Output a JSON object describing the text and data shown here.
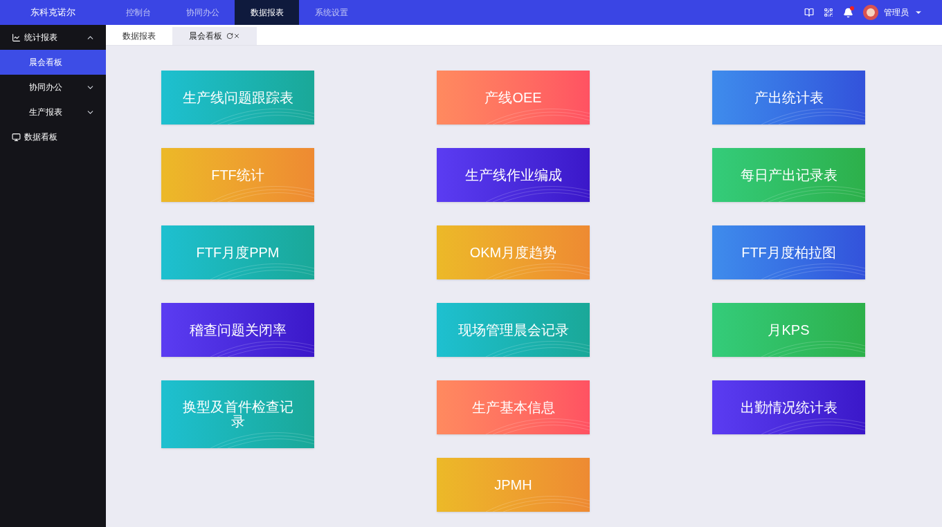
{
  "app_title": "东科克诺尔",
  "nav": [
    {
      "label": "控制台",
      "selected": false
    },
    {
      "label": "协同办公",
      "selected": false
    },
    {
      "label": "数据报表",
      "selected": true
    },
    {
      "label": "系统设置",
      "selected": false
    }
  ],
  "user": {
    "name": "管理员",
    "has_notification": true
  },
  "sidebar": {
    "items": [
      {
        "label": "统计报表",
        "kind": "chart",
        "expanded": true,
        "selected": false,
        "children": [
          {
            "label": "晨会看板",
            "selected": true
          },
          {
            "label": "协同办公",
            "selected": false,
            "expanded": false
          },
          {
            "label": "生产报表",
            "selected": false,
            "expanded": false
          }
        ]
      },
      {
        "label": "数据看板",
        "kind": "monitor",
        "selected": false
      }
    ]
  },
  "tabs": [
    {
      "label": "数据报表",
      "selected": false,
      "closable": false
    },
    {
      "label": "晨会看板",
      "selected": true,
      "closable": true
    }
  ],
  "cards": [
    {
      "label": "生产线问题跟踪表",
      "kind": "teal"
    },
    {
      "label": "产线OEE",
      "kind": "coral"
    },
    {
      "label": "产出统计表",
      "kind": "blue"
    },
    {
      "label": "FTF统计",
      "kind": "orange"
    },
    {
      "label": "生产线作业编成",
      "kind": "purple"
    },
    {
      "label": "每日产出记录表",
      "kind": "green"
    },
    {
      "label": "FTF月度PPM",
      "kind": "teal"
    },
    {
      "label": "OKM月度趋势",
      "kind": "orange"
    },
    {
      "label": "FTF月度柏拉图",
      "kind": "blue"
    },
    {
      "label": "稽查问题关闭率",
      "kind": "purple"
    },
    {
      "label": "现场管理晨会记录",
      "kind": "teal"
    },
    {
      "label": "月KPS",
      "kind": "green"
    },
    {
      "label": "换型及首件检查记录",
      "kind": "teal"
    },
    {
      "label": "生产基本信息",
      "kind": "coral"
    },
    {
      "label": "出勤情况统计表",
      "kind": "purple"
    },
    {
      "label": "JPMH",
      "kind": "orange"
    }
  ]
}
